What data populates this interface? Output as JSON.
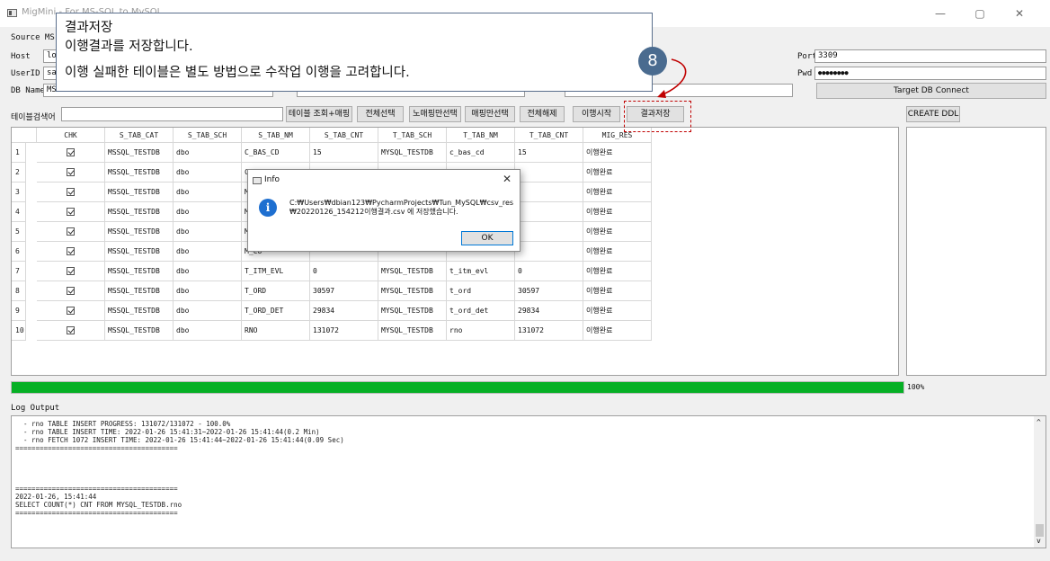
{
  "window": {
    "title": "MigMini - For MS-SQL to MySQL",
    "minimize": "—",
    "maximize": "▢",
    "close": "✕"
  },
  "source": {
    "label": "Source MS",
    "host_label": "Host",
    "host_value": "loc",
    "userid_label": "UserID",
    "userid_value": "sa",
    "dbname_label": "DB Name",
    "dbname_value": "MSS"
  },
  "target": {
    "port_label": "Port",
    "port_value": "3309",
    "pwd_label": "Pwd",
    "pwd_value": "●●●●●●●●",
    "connect_button": "Target DB Connect"
  },
  "toolbar": {
    "search_label": "테이블검색어",
    "search_value": "",
    "btn_table_query": "테이블 조회+매핑",
    "btn_select_all": "전체선택",
    "btn_yellow_only": "노매핑만선택",
    "btn_mapping_only": "매핑만선택",
    "btn_deselect_all": "전체해제",
    "btn_start_migration": "이행시작",
    "btn_save_result": "결과저장",
    "btn_create_ddl": "CREATE DDL"
  },
  "table": {
    "columns": [
      "CHK",
      "S_TAB_CAT",
      "S_TAB_SCH",
      "S_TAB_NM",
      "S_TAB_CNT",
      "T_TAB_SCH",
      "T_TAB_NM",
      "T_TAB_CNT",
      "MIG_RES"
    ],
    "rows": [
      {
        "no": "1",
        "cat": "MSSQL_TESTDB",
        "sch": "dbo",
        "nm": "C_BAS_CD",
        "cnt": "15",
        "tsch": "MYSQL_TESTDB",
        "tnm": "c_bas_cd",
        "tcnt": "15",
        "res": "이행완료"
      },
      {
        "no": "2",
        "cat": "MSSQL_TESTDB",
        "sch": "dbo",
        "nm": "C_BA",
        "cnt": "",
        "tsch": "",
        "tnm": "",
        "tcnt": "",
        "res": "이행완료"
      },
      {
        "no": "3",
        "cat": "MSSQL_TESTDB",
        "sch": "dbo",
        "nm": "M_IT",
        "cnt": "",
        "tsch": "",
        "tnm": "",
        "tcnt": "",
        "res": "이행완료"
      },
      {
        "no": "4",
        "cat": "MSSQL_TESTDB",
        "sch": "dbo",
        "nm": "M_IT",
        "cnt": "",
        "tsch": "",
        "tnm": "",
        "tcnt": "",
        "res": "이행완료"
      },
      {
        "no": "5",
        "cat": "MSSQL_TESTDB",
        "sch": "dbo",
        "nm": "M_RG",
        "cnt": "",
        "tsch": "",
        "tnm": "",
        "tcnt": "",
        "res": "이행완료"
      },
      {
        "no": "6",
        "cat": "MSSQL_TESTDB",
        "sch": "dbo",
        "nm": "M_CU",
        "cnt": "",
        "tsch": "",
        "tnm": "",
        "tcnt": "",
        "res": "이행완료"
      },
      {
        "no": "7",
        "cat": "MSSQL_TESTDB",
        "sch": "dbo",
        "nm": "T_ITM_EVL",
        "cnt": "0",
        "tsch": "MYSQL_TESTDB",
        "tnm": "t_itm_evl",
        "tcnt": "0",
        "res": "이행완료"
      },
      {
        "no": "8",
        "cat": "MSSQL_TESTDB",
        "sch": "dbo",
        "nm": "T_ORD",
        "cnt": "30597",
        "tsch": "MYSQL_TESTDB",
        "tnm": "t_ord",
        "tcnt": "30597",
        "res": "이행완료"
      },
      {
        "no": "9",
        "cat": "MSSQL_TESTDB",
        "sch": "dbo",
        "nm": "T_ORD_DET",
        "cnt": "29834",
        "tsch": "MYSQL_TESTDB",
        "tnm": "t_ord_det",
        "tcnt": "29834",
        "res": "이행완료"
      },
      {
        "no": "10",
        "cat": "MSSQL_TESTDB",
        "sch": "dbo",
        "nm": "RNO",
        "cnt": "131072",
        "tsch": "MYSQL_TESTDB",
        "tnm": "rno",
        "tcnt": "131072",
        "res": "이행완료"
      }
    ]
  },
  "progress": {
    "value": 1.0,
    "text": "100%",
    "color": "#06b025"
  },
  "log": {
    "label": "Log Output",
    "lines": [
      "  - rno TABLE INSERT PROGRESS: 131072/131072 - 100.0%",
      "  - rno TABLE INSERT TIME: 2022-01-26 15:41:31~2022-01-26 15:41:44(0.2 Min)",
      "  - rno FETCH 1072 INSERT TIME: 2022-01-26 15:41:44~2022-01-26 15:41:44(0.09 Sec)",
      "========================================",
      "",
      "",
      "",
      "",
      "========================================",
      "2022-01-26, 15:41:44",
      "SELECT COUNT(*) CNT FROM MYSQL_TESTDB.rno",
      "========================================"
    ],
    "scroll_up": "^",
    "scroll_down": "v"
  },
  "dialog": {
    "title": "Info",
    "icon": "i",
    "message_line1": "C:₩Users₩dbian123₩PycharmProjects₩Tun_MySQL₩csv_res",
    "message_line2": "₩20220126_154212이행결과.csv 에 저장했습니다.",
    "ok": "OK",
    "close": "✕"
  },
  "callout": {
    "line1": "결과저장",
    "line2": "이행결과를 저장합니다.",
    "line3": "이행 실패한 테이블은 별도 방법으로 수작업 이행을 고려합니다.",
    "step": "8",
    "accent": "#4a6b8f",
    "highlight_color": "#c00000"
  }
}
